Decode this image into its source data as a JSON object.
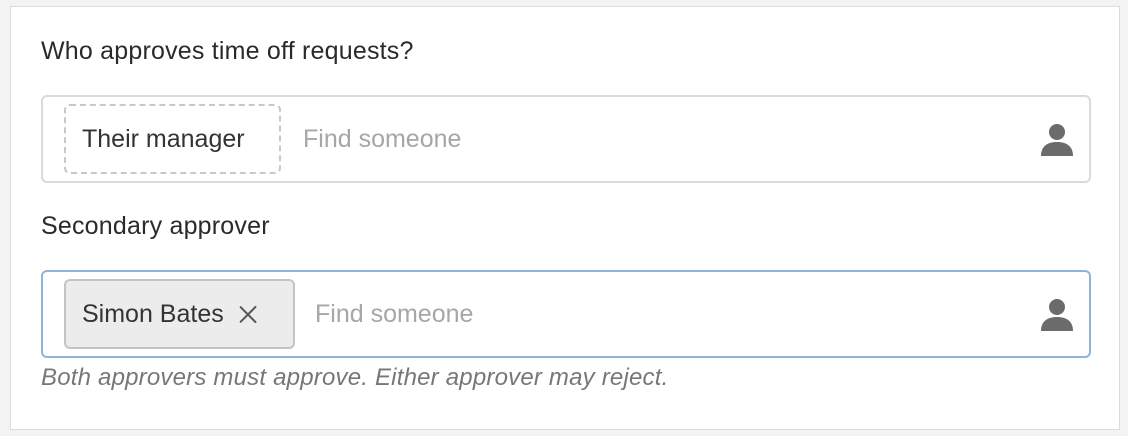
{
  "primary": {
    "label": "Who approves time off requests?",
    "token_label": "Their manager",
    "search_placeholder": "Find someone",
    "icon": "person-icon"
  },
  "secondary": {
    "label": "Secondary approver",
    "token_label": "Simon Bates",
    "remove_icon": "close-icon",
    "search_placeholder": "Find someone",
    "icon": "person-icon",
    "help_text": "Both approvers must approve. Either approver may reject."
  },
  "colors": {
    "focus_border": "#8fb4d9",
    "border": "#dadada",
    "placeholder": "#a6a6a6",
    "token_bg": "#ececec"
  }
}
